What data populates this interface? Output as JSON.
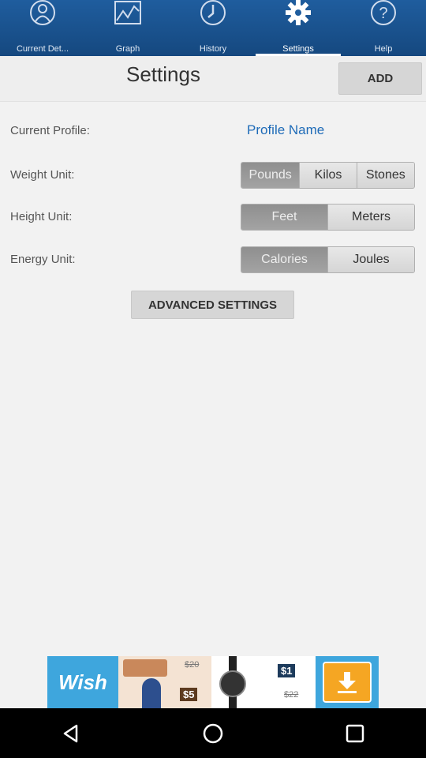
{
  "tabs": [
    {
      "label": "Current Det...",
      "icon": "user-icon",
      "active": false
    },
    {
      "label": "Graph",
      "icon": "graph-icon",
      "active": false
    },
    {
      "label": "History",
      "icon": "clock-icon",
      "active": false
    },
    {
      "label": "Settings",
      "icon": "gear-icon",
      "active": true
    },
    {
      "label": "Help",
      "icon": "help-icon",
      "active": false
    }
  ],
  "header": {
    "title": "Settings",
    "add_label": "ADD"
  },
  "profile": {
    "label": "Current Profile:",
    "value": "Profile Name"
  },
  "weight": {
    "label": "Weight Unit:",
    "options": [
      "Pounds",
      "Kilos",
      "Stones"
    ],
    "selected": "Pounds"
  },
  "height": {
    "label": "Height Unit:",
    "options": [
      "Feet",
      "Meters"
    ],
    "selected": "Feet"
  },
  "energy": {
    "label": "Energy Unit:",
    "options": [
      "Calories",
      "Joules"
    ],
    "selected": "Calories"
  },
  "advanced_label": "ADVANCED SETTINGS",
  "ad": {
    "brand": "Wish",
    "prices": [
      "$20",
      "$5",
      "$1",
      "$22"
    ]
  },
  "colors": {
    "tabbar": "#1f5d9e",
    "accent_link": "#1e6bb8",
    "ad_bg": "#3ea6dd"
  }
}
